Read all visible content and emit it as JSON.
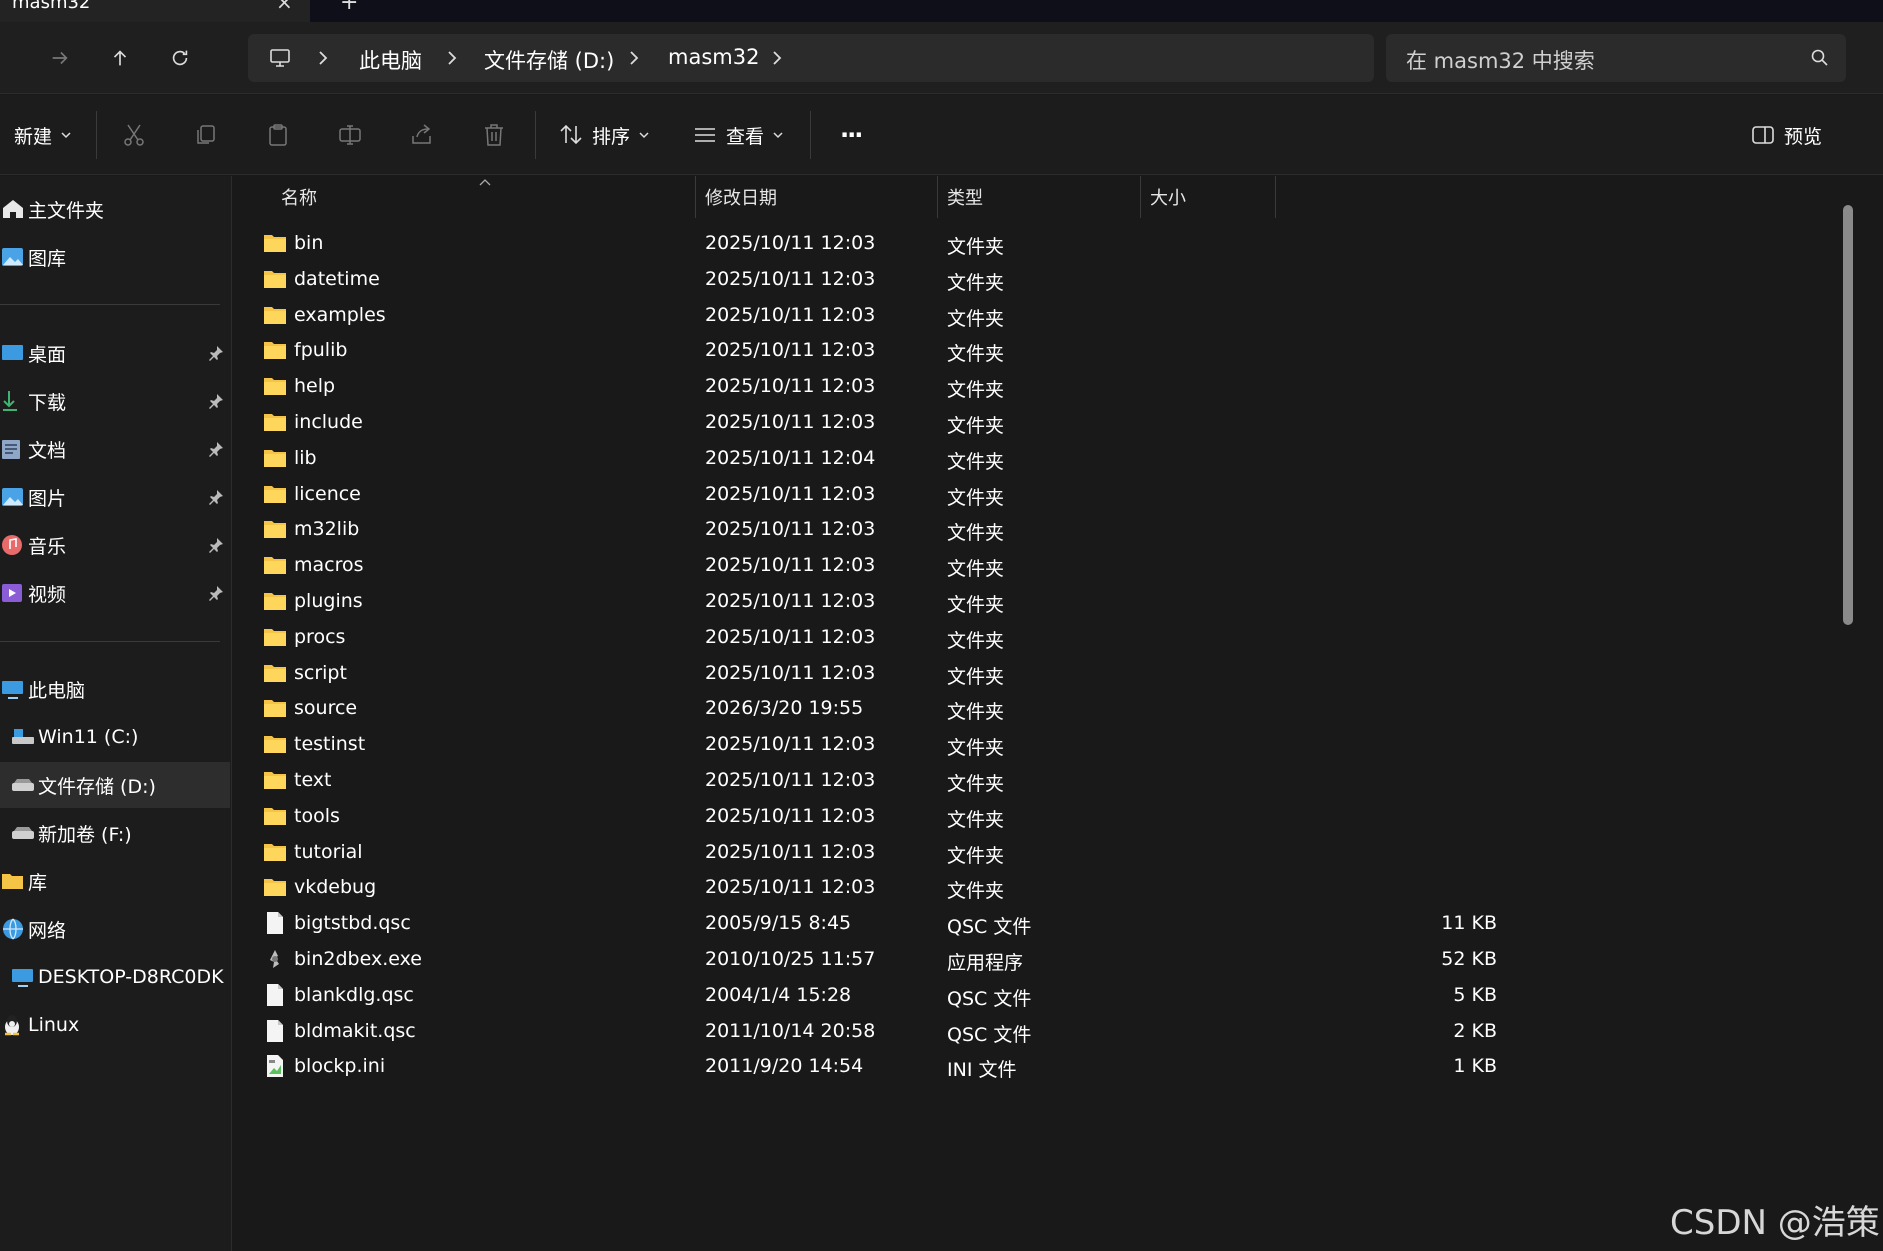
{
  "window": {
    "tab_title": "masm32",
    "tab_close": "×",
    "tab_new": "+"
  },
  "breadcrumb": [
    "此电脑",
    "文件存储 (D:)",
    "masm32"
  ],
  "search": {
    "placeholder": "在 masm32 中搜索"
  },
  "toolbar": {
    "new_label": "新建",
    "sort_label": "排序",
    "view_label": "查看",
    "more_label": "···",
    "preview_label": "预览"
  },
  "sidebar": {
    "items": [
      {
        "label": "主文件夹",
        "icon": "home-icon"
      },
      {
        "label": "图库",
        "icon": "gallery-icon"
      },
      {
        "label": "桌面",
        "icon": "desktop-icon",
        "pinned": true
      },
      {
        "label": "下载",
        "icon": "download-icon",
        "pinned": true
      },
      {
        "label": "文档",
        "icon": "document-icon",
        "pinned": true
      },
      {
        "label": "图片",
        "icon": "pictures-icon",
        "pinned": true
      },
      {
        "label": "音乐",
        "icon": "music-icon",
        "pinned": true
      },
      {
        "label": "视频",
        "icon": "video-icon",
        "pinned": true
      },
      {
        "label": "此电脑",
        "icon": "computer-icon"
      },
      {
        "label": "Win11 (C:)",
        "icon": "drive-icon"
      },
      {
        "label": "文件存储 (D:)",
        "icon": "drive-icon",
        "selected": true
      },
      {
        "label": "新加卷 (F:)",
        "icon": "drive-icon"
      },
      {
        "label": "库",
        "icon": "library-icon"
      },
      {
        "label": "网络",
        "icon": "network-icon"
      },
      {
        "label": "DESKTOP-D8RC0DK",
        "icon": "computer-icon"
      },
      {
        "label": "Linux",
        "icon": "linux-icon"
      }
    ]
  },
  "columns": {
    "name": "名称",
    "date": "修改日期",
    "type": "类型",
    "size": "大小"
  },
  "files": [
    {
      "name": "bin",
      "date": "2025/10/11 12:03",
      "type": "文件夹",
      "size": "",
      "icon": "folder-icon"
    },
    {
      "name": "datetime",
      "date": "2025/10/11 12:03",
      "type": "文件夹",
      "size": "",
      "icon": "folder-icon"
    },
    {
      "name": "examples",
      "date": "2025/10/11 12:03",
      "type": "文件夹",
      "size": "",
      "icon": "folder-icon"
    },
    {
      "name": "fpulib",
      "date": "2025/10/11 12:03",
      "type": "文件夹",
      "size": "",
      "icon": "folder-icon"
    },
    {
      "name": "help",
      "date": "2025/10/11 12:03",
      "type": "文件夹",
      "size": "",
      "icon": "folder-icon"
    },
    {
      "name": "include",
      "date": "2025/10/11 12:03",
      "type": "文件夹",
      "size": "",
      "icon": "folder-icon"
    },
    {
      "name": "lib",
      "date": "2025/10/11 12:04",
      "type": "文件夹",
      "size": "",
      "icon": "folder-icon"
    },
    {
      "name": "licence",
      "date": "2025/10/11 12:03",
      "type": "文件夹",
      "size": "",
      "icon": "folder-icon"
    },
    {
      "name": "m32lib",
      "date": "2025/10/11 12:03",
      "type": "文件夹",
      "size": "",
      "icon": "folder-icon"
    },
    {
      "name": "macros",
      "date": "2025/10/11 12:03",
      "type": "文件夹",
      "size": "",
      "icon": "folder-icon"
    },
    {
      "name": "plugins",
      "date": "2025/10/11 12:03",
      "type": "文件夹",
      "size": "",
      "icon": "folder-icon"
    },
    {
      "name": "procs",
      "date": "2025/10/11 12:03",
      "type": "文件夹",
      "size": "",
      "icon": "folder-icon"
    },
    {
      "name": "script",
      "date": "2025/10/11 12:03",
      "type": "文件夹",
      "size": "",
      "icon": "folder-icon"
    },
    {
      "name": "source",
      "date": "2026/3/20 19:55",
      "type": "文件夹",
      "size": "",
      "icon": "folder-icon"
    },
    {
      "name": "testinst",
      "date": "2025/10/11 12:03",
      "type": "文件夹",
      "size": "",
      "icon": "folder-icon"
    },
    {
      "name": "text",
      "date": "2025/10/11 12:03",
      "type": "文件夹",
      "size": "",
      "icon": "folder-icon"
    },
    {
      "name": "tools",
      "date": "2025/10/11 12:03",
      "type": "文件夹",
      "size": "",
      "icon": "folder-icon"
    },
    {
      "name": "tutorial",
      "date": "2025/10/11 12:03",
      "type": "文件夹",
      "size": "",
      "icon": "folder-icon"
    },
    {
      "name": "vkdebug",
      "date": "2025/10/11 12:03",
      "type": "文件夹",
      "size": "",
      "icon": "folder-icon"
    },
    {
      "name": "bigtstbd.qsc",
      "date": "2005/9/15 8:45",
      "type": "QSC 文件",
      "size": "11 KB",
      "icon": "file-icon"
    },
    {
      "name": "bin2dbex.exe",
      "date": "2010/10/25 11:57",
      "type": "应用程序",
      "size": "52 KB",
      "icon": "exe-icon"
    },
    {
      "name": "blankdlg.qsc",
      "date": "2004/1/4 15:28",
      "type": "QSC 文件",
      "size": "5 KB",
      "icon": "file-icon"
    },
    {
      "name": "bldmakit.qsc",
      "date": "2011/10/14 20:58",
      "type": "QSC 文件",
      "size": "2 KB",
      "icon": "file-icon"
    },
    {
      "name": "blockp.ini",
      "date": "2011/9/20 14:54",
      "type": "INI 文件",
      "size": "1 KB",
      "icon": "ini-icon"
    }
  ],
  "watermark": "CSDN @浩策",
  "colors": {
    "folder": "#f5c446",
    "accent": "#4cc2ff",
    "background": "#191919"
  }
}
